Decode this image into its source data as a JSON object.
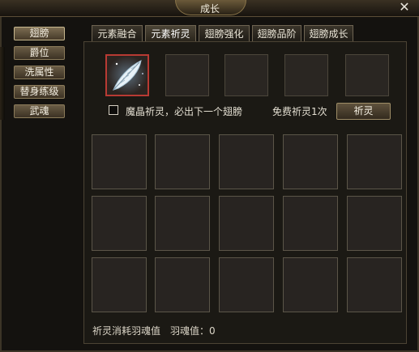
{
  "window": {
    "title": "成长",
    "close_glyph": "✕"
  },
  "sidebar": {
    "items": [
      {
        "label": "翅膀",
        "active": true
      },
      {
        "label": "爵位",
        "active": false
      },
      {
        "label": "洗属性",
        "active": false
      },
      {
        "label": "替身练级",
        "active": false
      },
      {
        "label": "武魂",
        "active": false
      }
    ]
  },
  "tabs": [
    {
      "label": "元素融合",
      "active": false
    },
    {
      "label": "元素祈灵",
      "active": true
    },
    {
      "label": "翅膀强化",
      "active": false
    },
    {
      "label": "翅膀品阶",
      "active": false
    },
    {
      "label": "翅膀成长",
      "active": false
    }
  ],
  "prayer": {
    "top_slots": [
      {
        "item": "feather-icon"
      },
      {
        "item": ""
      },
      {
        "item": ""
      },
      {
        "item": ""
      },
      {
        "item": ""
      }
    ],
    "checkbox_label": "魔晶祈灵，必出下一个翅膀",
    "checkbox_checked": false,
    "free_text": "免费祈灵1次",
    "pray_button": "祈灵"
  },
  "reward_grid": {
    "rows": 3,
    "cols": 5
  },
  "footer": {
    "cost_label": "祈灵消耗羽魂值",
    "feather_value_label": "羽魂值：0"
  },
  "colors": {
    "accent_border": "#b83a33",
    "panel_bg": "#1b1914",
    "slot_bg": "#282421"
  }
}
